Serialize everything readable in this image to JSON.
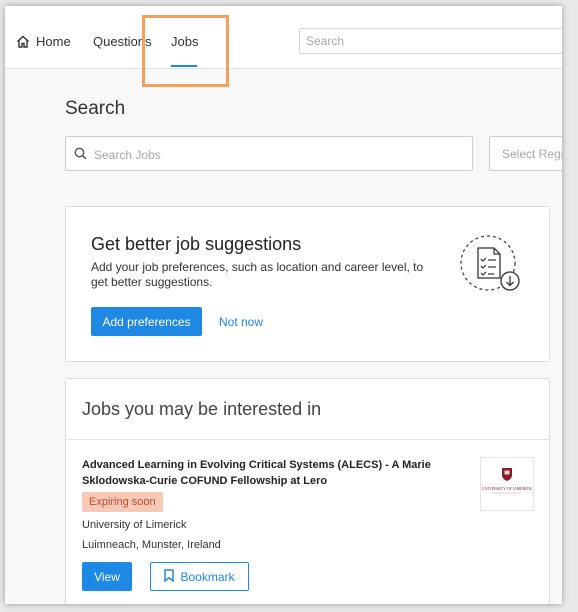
{
  "nav": {
    "home_label": "Home",
    "questions_label": "Questions",
    "jobs_label": "Jobs",
    "search_placeholder": "Search"
  },
  "page": {
    "title": "Search"
  },
  "search": {
    "jobs_placeholder": "Search Jobs",
    "region_placeholder": "Select Region"
  },
  "preferences": {
    "title": "Get better job suggestions",
    "description": "Add your job preferences, such as location and career level, to get better suggestions.",
    "add_button": "Add preferences",
    "not_now": "Not now"
  },
  "jobs": {
    "section_title": "Jobs you may be interested in",
    "items": [
      {
        "title": "Advanced Learning in Evolving Critical Systems (ALECS) - A Marie Sklodowska-Curie COFUND Fellowship at Lero",
        "badge": "Expiring soon",
        "organization": "University of Limerick",
        "location": "Luimneach, Munster, Ireland",
        "view_label": "View",
        "bookmark_label": "Bookmark",
        "logo_text": "UNIVERSITY OF LIMERICK"
      }
    ]
  },
  "colors": {
    "accent": "#1e88e5",
    "highlight": "#f5a05b",
    "badge_bg": "#f7c9b6",
    "badge_text": "#c44a2a",
    "logo": "#8b1a2b"
  },
  "icons": {
    "home": "home-icon",
    "search": "search-icon",
    "preferences": "document-checklist-download-icon",
    "bookmark": "bookmark-icon"
  }
}
